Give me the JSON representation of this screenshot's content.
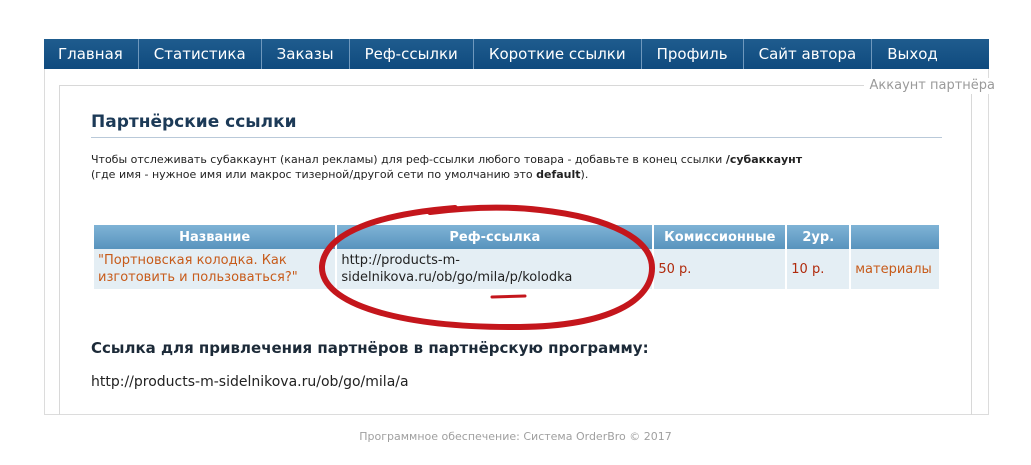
{
  "nav": {
    "items": [
      {
        "label": "Главная"
      },
      {
        "label": "Статистика"
      },
      {
        "label": "Заказы"
      },
      {
        "label": "Реф-ссылки"
      },
      {
        "label": "Короткие ссылки"
      },
      {
        "label": "Профиль"
      },
      {
        "label": "Сайт автора"
      },
      {
        "label": "Выход"
      }
    ]
  },
  "panel": {
    "legend": "Аккаунт партнёра",
    "title": "Партнёрские ссылки",
    "hint_line1_prefix": "Чтобы отслеживать субаккаунт (канал рекламы) для реф-ссылки любого товара - добавьте в конец ссылки ",
    "hint_line1_bold": "/субаккаунт",
    "hint_line2_prefix": "(где имя - нужное имя или макрос тизерной/другой сети по умолчанию это ",
    "hint_line2_bold": "default",
    "hint_line2_suffix": ")."
  },
  "table": {
    "headers": [
      "Название",
      "Реф-ссылка",
      "Комиссионные",
      "2ур.",
      ""
    ],
    "rows": [
      {
        "name": "\"Портновская колодка. Как изготовить и пользоваться?\"",
        "link_line1": "http://products-m-",
        "link_line2": "sidelnikova.ru/ob/go/mila/p/kolodka",
        "commission": "50 р.",
        "level2": "10 р.",
        "materials": "материалы"
      }
    ]
  },
  "partner": {
    "title": "Ссылка для привлечения партнёров в партнёрскую программу:",
    "link": "http://products-m-sidelnikova.ru/ob/go/mila/a"
  },
  "footer": "Программное обеспечение: Система OrderBro © 2017",
  "colors": {
    "nav_bg": "#12507f",
    "header_bg": "#6aa3ca",
    "row_bg": "#e4eef4",
    "accent_orange": "#c75b1a",
    "price_red": "#b02a0c",
    "annotation_red": "#c4161c"
  }
}
